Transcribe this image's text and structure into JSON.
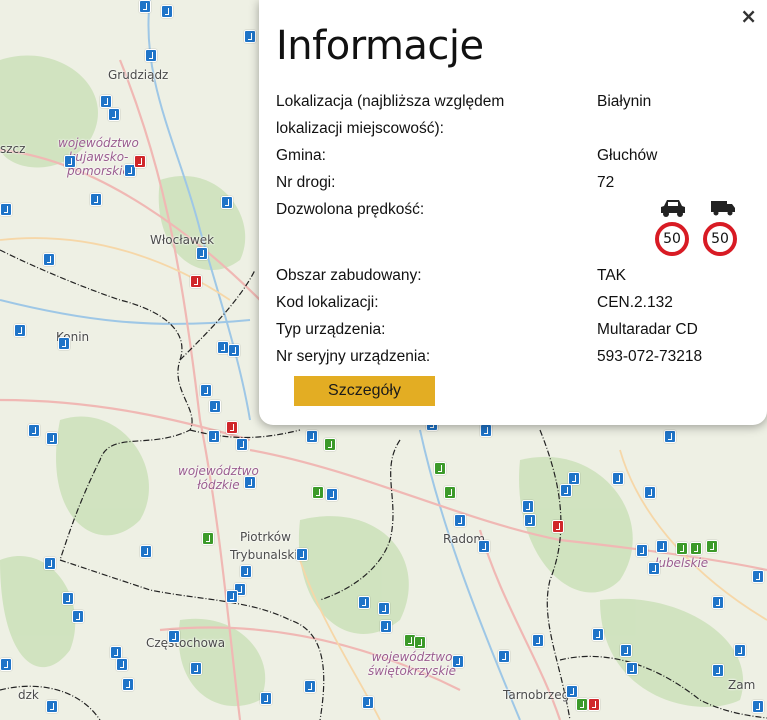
{
  "popup": {
    "title": "Informacje",
    "close_label": "×",
    "rows": [
      {
        "label": "Lokalizacja (najbliższa względem lokalizacji miejscowość):",
        "value": "Białynin"
      },
      {
        "label": "Gmina:",
        "value": "Głuchów"
      },
      {
        "label": "Nr drogi:",
        "value": "72"
      }
    ],
    "speed": {
      "label": "Dozwolona prędkość:",
      "car_limit": "50",
      "truck_limit": "50",
      "car_icon": "car-icon",
      "truck_icon": "truck-icon"
    },
    "rows2": [
      {
        "label": "Obszar zabudowany:",
        "value": "TAK"
      },
      {
        "label": "Kod lokalizacji:",
        "value": "CEN.2.132"
      },
      {
        "label": "Typ urządzenia:",
        "value": "Multaradar CD"
      },
      {
        "label": "Nr seryjny urządzenia:",
        "value": "593-072-73218"
      }
    ],
    "details_button": "Szczegóły",
    "button_color": "#e3ad23"
  },
  "map": {
    "cities": [
      "Grudziądz",
      "szcz",
      "Włocławek",
      "Konin",
      "Piotrków",
      "Trybunalski",
      "Radom",
      "Częstochowa",
      "Tarnobrzeg",
      "Zam",
      "dzk"
    ],
    "regions": [
      {
        "lines": [
          "województwo",
          "kujawsko-",
          "pomorskie"
        ]
      },
      {
        "lines": [
          "województwo",
          "łódzkie"
        ]
      },
      {
        "lines": [
          "województwo",
          "świętokrzyskie"
        ]
      },
      {
        "lines": [
          "lubelskie"
        ]
      }
    ],
    "marker_colors": {
      "blue": "#1f74c8",
      "green": "#3c9a2a",
      "red": "#d0262a"
    }
  }
}
